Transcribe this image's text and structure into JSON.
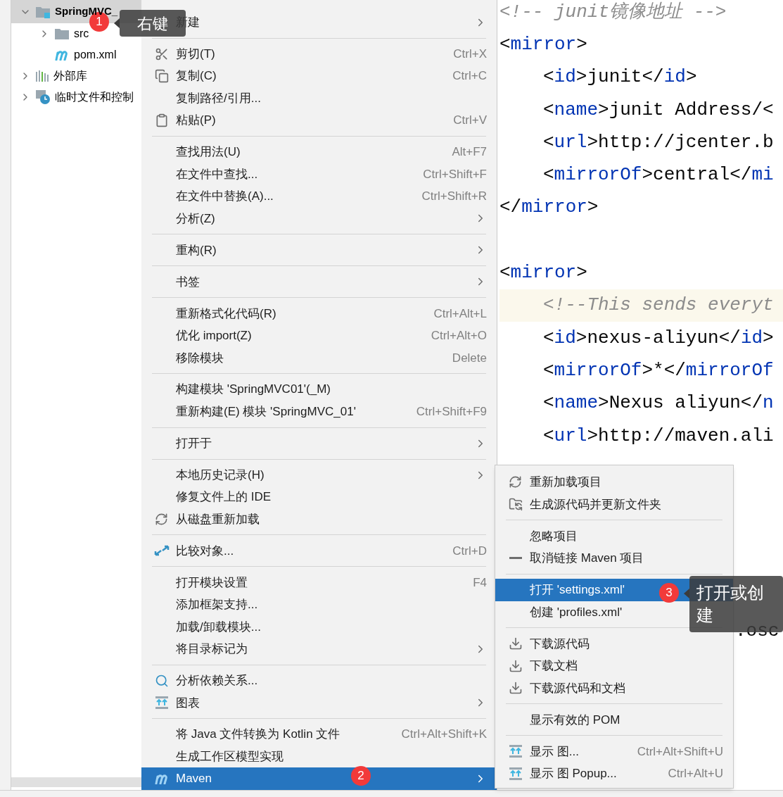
{
  "tree": [
    {
      "label": "SpringMVC_",
      "kind": "project",
      "expanded": true,
      "selected": true,
      "children": [
        {
          "label": "src",
          "kind": "folder",
          "expanded": false,
          "selected": false
        },
        {
          "label": "pom.xml",
          "kind": "file",
          "selected": false
        }
      ]
    },
    {
      "label": "外部库",
      "kind": "library",
      "expanded": false,
      "selected": false
    },
    {
      "label": "临时文件和控制",
      "kind": "scratch",
      "expanded": false,
      "selected": false
    }
  ],
  "context_menu": {
    "items": [
      {
        "label": "新建",
        "submenu": true,
        "selected": false
      },
      {
        "label": "剪切(T)",
        "shortcut": "Ctrl+X",
        "separator_before": true,
        "selected": false
      },
      {
        "label": "复制(C)",
        "shortcut": "Ctrl+C",
        "selected": false
      },
      {
        "label": "复制路径/引用...",
        "selected": false
      },
      {
        "label": "粘贴(P)",
        "shortcut": "Ctrl+V",
        "selected": false
      },
      {
        "label": "查找用法(U)",
        "shortcut": "Alt+F7",
        "separator_before": true,
        "selected": false
      },
      {
        "label": "在文件中查找...",
        "shortcut": "Ctrl+Shift+F",
        "selected": false
      },
      {
        "label": "在文件中替换(A)...",
        "shortcut": "Ctrl+Shift+R",
        "selected": false
      },
      {
        "label": "分析(Z)",
        "submenu": true,
        "selected": false
      },
      {
        "label": "重构(R)",
        "submenu": true,
        "separator_before": true,
        "selected": false
      },
      {
        "label": "书签",
        "submenu": true,
        "separator_before": true,
        "selected": false
      },
      {
        "label": "重新格式化代码(R)",
        "shortcut": "Ctrl+Alt+L",
        "separator_before": true,
        "selected": false
      },
      {
        "label": "优化 import(Z)",
        "shortcut": "Ctrl+Alt+O",
        "selected": false
      },
      {
        "label": "移除模块",
        "shortcut": "Delete",
        "selected": false
      },
      {
        "label": "构建模块 'SpringMVC01'(_M)",
        "separator_before": true,
        "selected": false
      },
      {
        "label": "重新构建(E) 模块 'SpringMVC_01'",
        "shortcut": "Ctrl+Shift+F9",
        "selected": false
      },
      {
        "label": "打开于",
        "submenu": true,
        "separator_before": true,
        "selected": false
      },
      {
        "label": "本地历史记录(H)",
        "submenu": true,
        "separator_before": true,
        "selected": false
      },
      {
        "label": "修复文件上的 IDE",
        "selected": false
      },
      {
        "label": "从磁盘重新加载",
        "selected": false
      },
      {
        "label": "比较对象...",
        "shortcut": "Ctrl+D",
        "separator_before": true,
        "selected": false
      },
      {
        "label": "打开模块设置",
        "shortcut": "F4",
        "separator_before": true,
        "selected": false
      },
      {
        "label": "添加框架支持...",
        "selected": false
      },
      {
        "label": "加载/卸载模块...",
        "selected": false
      },
      {
        "label": "将目录标记为",
        "submenu": true,
        "selected": false
      },
      {
        "label": "分析依赖关系...",
        "separator_before": true,
        "selected": false
      },
      {
        "label": "图表",
        "submenu": true,
        "selected": false
      },
      {
        "label": "将 Java 文件转换为 Kotlin 文件",
        "shortcut": "Ctrl+Alt+Shift+K",
        "separator_before": true,
        "selected": false
      },
      {
        "label": "生成工作区模型实现",
        "selected": false
      },
      {
        "label": "Maven",
        "submenu": true,
        "selected": true
      }
    ]
  },
  "maven_submenu": {
    "items": [
      {
        "label": "重新加载项目",
        "selected": false
      },
      {
        "label": "生成源代码并更新文件夹",
        "selected": false
      },
      {
        "label": "忽略项目",
        "separator_before": true,
        "selected": false
      },
      {
        "label": "取消链接 Maven 项目",
        "selected": false
      },
      {
        "label": "打开 'settings.xml'",
        "separator_before": true,
        "selected": true
      },
      {
        "label": "创建 'profiles.xml'",
        "selected": false
      },
      {
        "label": "下载源代码",
        "separator_before": true,
        "selected": false
      },
      {
        "label": "下载文档",
        "selected": false
      },
      {
        "label": "下载源代码和文档",
        "selected": false
      },
      {
        "label": "显示有效的 POM",
        "separator_before": true,
        "selected": false
      },
      {
        "label": "显示 图...",
        "shortcut": "Ctrl+Alt+Shift+U",
        "separator_before": true,
        "selected": false
      },
      {
        "label": "显示 图 Popup...",
        "shortcut": "Ctrl+Alt+U",
        "selected": false
      }
    ]
  },
  "editor": {
    "lines": [
      {
        "indented": false,
        "highlighted": false,
        "segments": [
          {
            "kind": "comment",
            "text": "<!-- junit镜像地址 -->"
          }
        ]
      },
      {
        "indented": false,
        "highlighted": false,
        "segments": [
          {
            "kind": "text",
            "text": "<"
          },
          {
            "kind": "tag",
            "text": "mirror"
          },
          {
            "kind": "text",
            "text": ">"
          }
        ]
      },
      {
        "indented": true,
        "highlighted": false,
        "segments": [
          {
            "kind": "text",
            "text": "<"
          },
          {
            "kind": "tag",
            "text": "id"
          },
          {
            "kind": "text",
            "text": ">junit</"
          },
          {
            "kind": "tag",
            "text": "id"
          },
          {
            "kind": "text",
            "text": ">"
          }
        ]
      },
      {
        "indented": true,
        "highlighted": false,
        "segments": [
          {
            "kind": "text",
            "text": "<"
          },
          {
            "kind": "tag",
            "text": "name"
          },
          {
            "kind": "text",
            "text": ">junit Address/<"
          }
        ]
      },
      {
        "indented": true,
        "highlighted": false,
        "segments": [
          {
            "kind": "text",
            "text": "<"
          },
          {
            "kind": "tag",
            "text": "url"
          },
          {
            "kind": "text",
            "text": ">http://jcenter.b"
          }
        ]
      },
      {
        "indented": true,
        "highlighted": false,
        "segments": [
          {
            "kind": "text",
            "text": "<"
          },
          {
            "kind": "tag",
            "text": "mirrorOf"
          },
          {
            "kind": "text",
            "text": ">central</"
          },
          {
            "kind": "tag",
            "text": "mi"
          }
        ]
      },
      {
        "indented": false,
        "highlighted": false,
        "segments": [
          {
            "kind": "text",
            "text": "</"
          },
          {
            "kind": "tag",
            "text": "mirror"
          },
          {
            "kind": "text",
            "text": ">"
          }
        ]
      },
      {
        "indented": false,
        "highlighted": false,
        "blank_before": true,
        "segments": [
          {
            "kind": "text",
            "text": "<"
          },
          {
            "kind": "tag",
            "text": "mirror"
          },
          {
            "kind": "text",
            "text": ">"
          }
        ]
      },
      {
        "indented": true,
        "highlighted": true,
        "segments": [
          {
            "kind": "comment",
            "text": "<!--This sends everyt"
          }
        ]
      },
      {
        "indented": true,
        "highlighted": false,
        "segments": [
          {
            "kind": "text",
            "text": "<"
          },
          {
            "kind": "tag",
            "text": "id"
          },
          {
            "kind": "text",
            "text": ">nexus-aliyun</"
          },
          {
            "kind": "tag",
            "text": "id"
          },
          {
            "kind": "text",
            "text": ">"
          }
        ]
      },
      {
        "indented": true,
        "highlighted": false,
        "segments": [
          {
            "kind": "text",
            "text": "<"
          },
          {
            "kind": "tag",
            "text": "mirrorOf"
          },
          {
            "kind": "text",
            "text": ">*</"
          },
          {
            "kind": "tag",
            "text": "mirrorOf"
          }
        ]
      },
      {
        "indented": true,
        "highlighted": false,
        "segments": [
          {
            "kind": "text",
            "text": "<"
          },
          {
            "kind": "tag",
            "text": "name"
          },
          {
            "kind": "text",
            "text": ">Nexus aliyun</"
          },
          {
            "kind": "tag",
            "text": "n"
          }
        ]
      },
      {
        "indented": true,
        "highlighted": false,
        "segments": [
          {
            "kind": "text",
            "text": "<"
          },
          {
            "kind": "tag",
            "text": "url"
          },
          {
            "kind": "text",
            "text": ">http://maven.ali"
          }
        ]
      }
    ],
    "tail_line": ".osc"
  },
  "callouts": [
    {
      "number": "1",
      "tip": "右键"
    },
    {
      "number": "2"
    },
    {
      "number": "3",
      "tip": "打开或创建"
    }
  ]
}
